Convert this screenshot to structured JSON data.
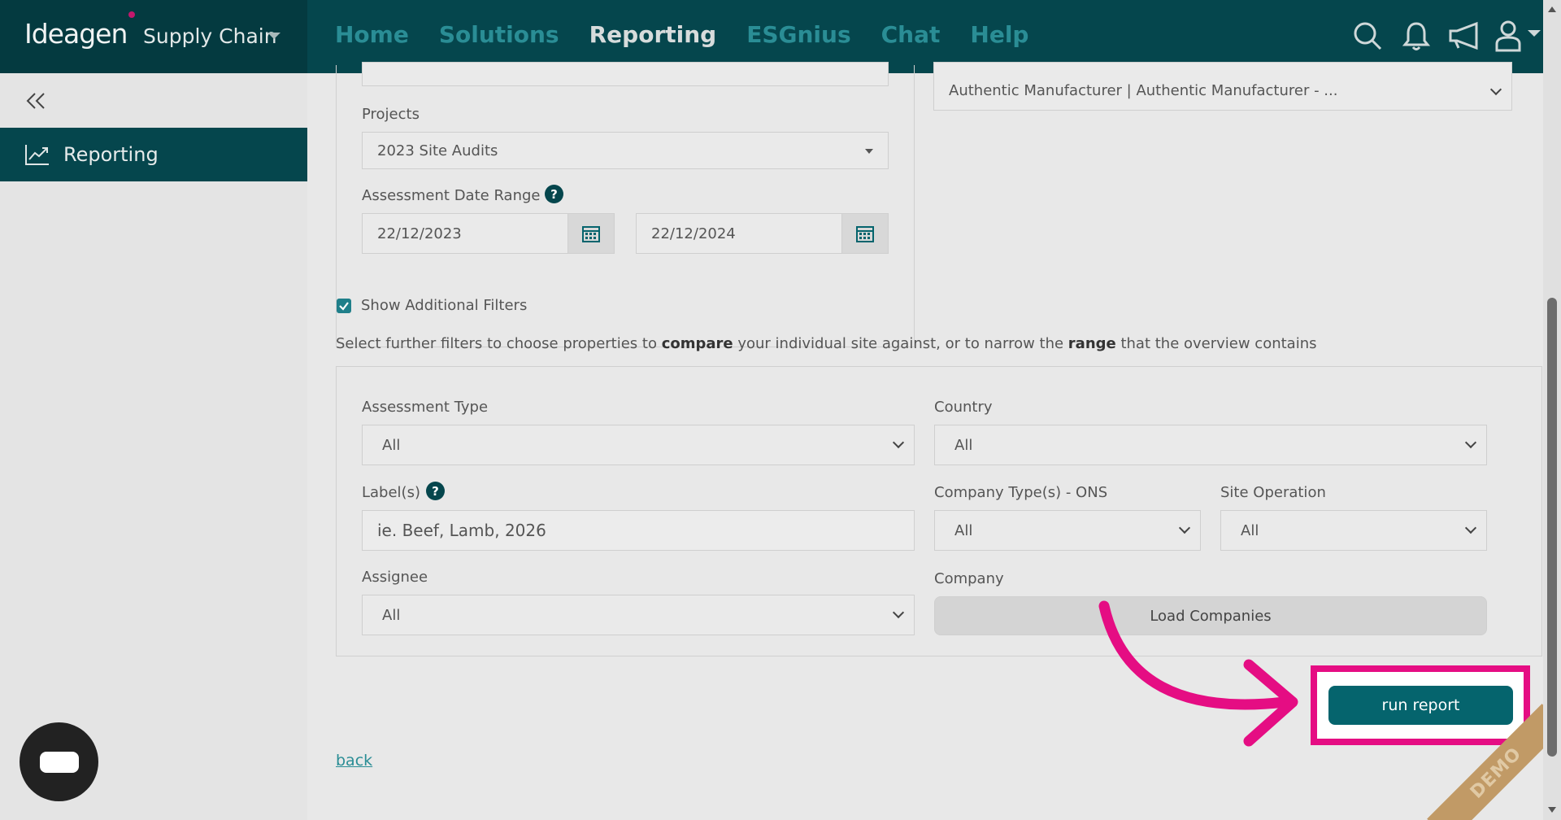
{
  "brand": {
    "logo": "Ideagen",
    "product": "Supply Chain"
  },
  "nav": {
    "items": [
      "Home",
      "Solutions",
      "Reporting",
      "ESGnius",
      "Chat",
      "Help"
    ],
    "active": "Reporting"
  },
  "sidebar": {
    "item_label": "Reporting"
  },
  "form": {
    "supplier_value": "Authentic Manufacturer | Authentic Manufacturer - ...",
    "projects_label": "Projects",
    "projects_value": "2023 Site Audits",
    "date_range_label": "Assessment Date Range",
    "date_from": "22/12/2023",
    "date_to": "22/12/2024",
    "show_filters_label": "Show Additional Filters",
    "show_filters_checked": true,
    "desc_part1": "Select further filters to choose properties to ",
    "desc_bold1": "compare",
    "desc_part2": " your individual site against, or to narrow the ",
    "desc_bold2": "range",
    "desc_part3": " that the overview contains"
  },
  "filters": {
    "assessment_type_label": "Assessment Type",
    "assessment_type_value": "All",
    "country_label": "Country",
    "country_value": "All",
    "labels_label": "Label(s)",
    "labels_placeholder": "ie. Beef, Lamb, 2026",
    "company_type_label": "Company Type(s) - ONS",
    "company_type_value": "All",
    "site_operation_label": "Site Operation",
    "site_operation_value": "All",
    "assignee_label": "Assignee",
    "assignee_value": "All",
    "company_label": "Company",
    "load_companies_label": "Load Companies"
  },
  "actions": {
    "run_report": "run report",
    "back": "back"
  },
  "help_glyph": "?",
  "demo_ribbon": "DEMO",
  "colors": {
    "nav_bg": "#05464d",
    "accent": "#05646d",
    "highlight": "#e50d83"
  }
}
